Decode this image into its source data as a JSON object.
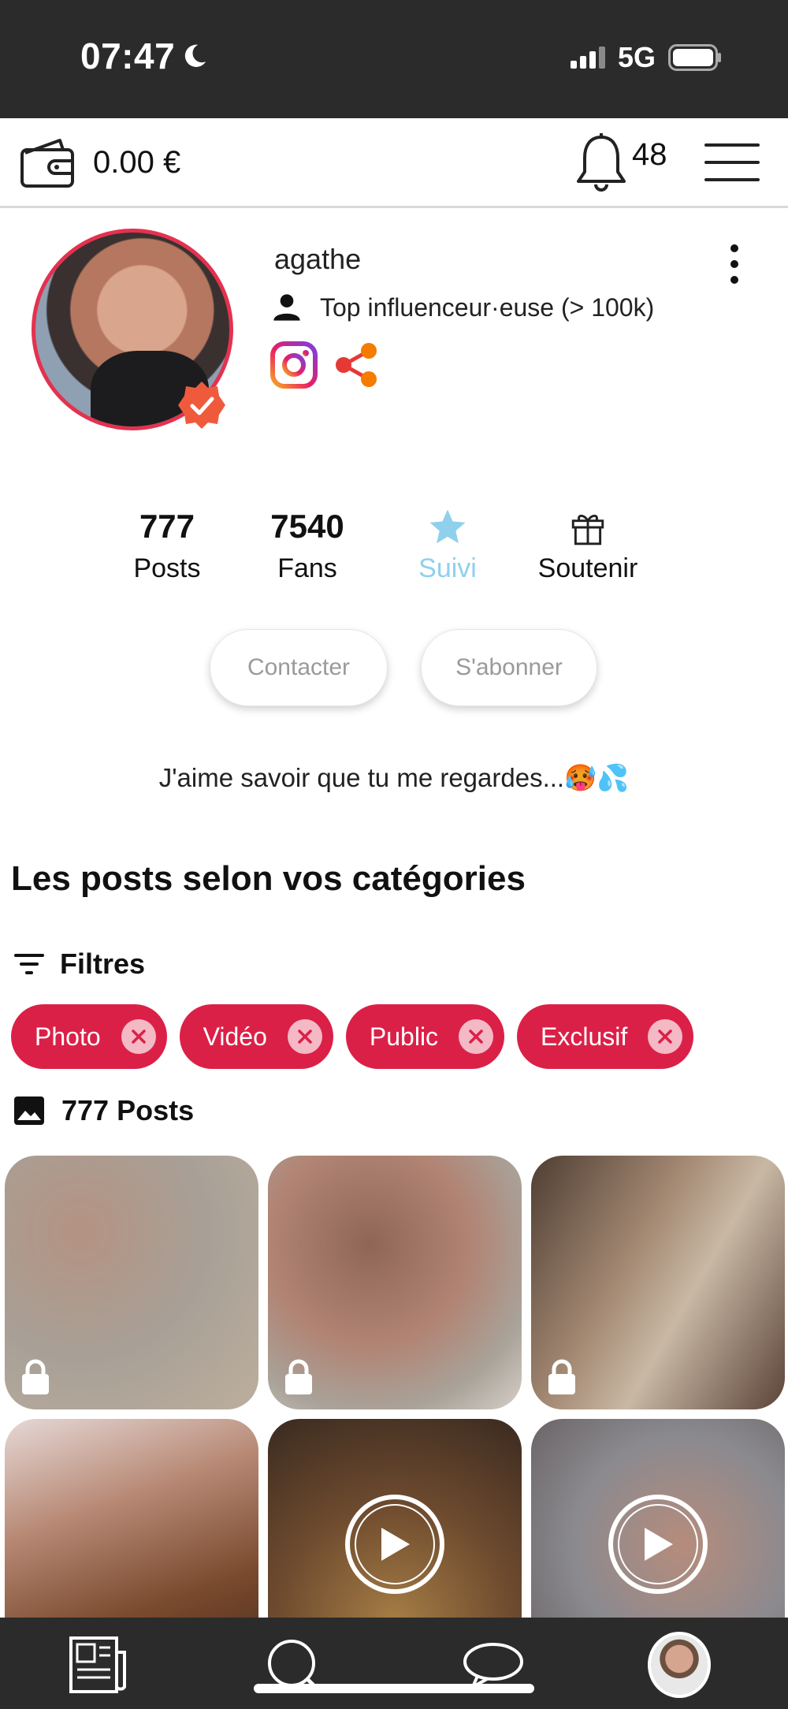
{
  "status_bar": {
    "time": "07:47",
    "network": "5G"
  },
  "header": {
    "wallet_amount": "0.00 €",
    "notification_count": "48"
  },
  "profile": {
    "username": "agathe",
    "role": "Top influenceur·euse (> 100k)",
    "stats": {
      "posts_value": "777",
      "posts_label": "Posts",
      "fans_value": "7540",
      "fans_label": "Fans",
      "followed_label": "Suivi",
      "support_label": "Soutenir"
    },
    "contact_label": "Contacter",
    "subscribe_label": "S'abonner",
    "bio": "J'aime savoir que tu me regardes...🥵💦"
  },
  "posts_section": {
    "title": "Les posts selon vos catégories",
    "filters_label": "Filtres",
    "chips": [
      "Photo",
      "Vidéo",
      "Public",
      "Exclusif"
    ],
    "posts_count": "777 Posts"
  },
  "colors": {
    "accent": "#db2048",
    "followed": "#8fd0ec",
    "dark_bar": "#2b2b2b"
  }
}
